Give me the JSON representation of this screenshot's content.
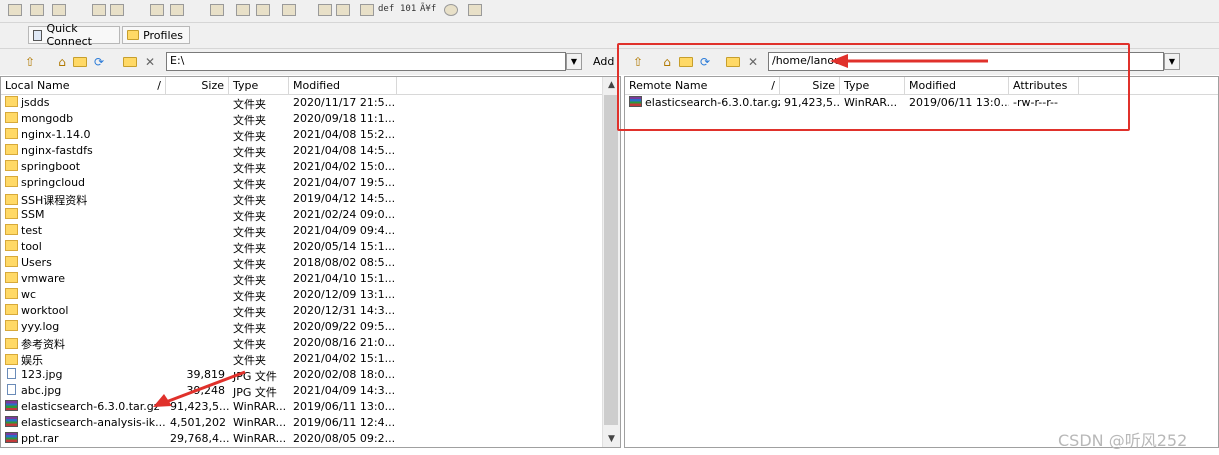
{
  "toolbar": {
    "quick_connect": "Quick Connect",
    "profiles": "Profiles",
    "text_tools": [
      "def",
      "101",
      "Ã¥f"
    ]
  },
  "local": {
    "path": "E:\\",
    "add_label": "Add",
    "headers": {
      "name": "Local Name",
      "sort": "/",
      "size": "Size",
      "type": "Type",
      "modified": "Modified"
    },
    "rows": [
      {
        "name": "jsdds",
        "size": "",
        "type": "文件夹",
        "modified": "2020/11/17 21:5...",
        "icon": "folder"
      },
      {
        "name": "mongodb",
        "size": "",
        "type": "文件夹",
        "modified": "2020/09/18 11:1...",
        "icon": "folder"
      },
      {
        "name": "nginx-1.14.0",
        "size": "",
        "type": "文件夹",
        "modified": "2021/04/08 15:2...",
        "icon": "folder"
      },
      {
        "name": "nginx-fastdfs",
        "size": "",
        "type": "文件夹",
        "modified": "2021/04/08 14:5...",
        "icon": "folder"
      },
      {
        "name": "springboot",
        "size": "",
        "type": "文件夹",
        "modified": "2021/04/02 15:0...",
        "icon": "folder"
      },
      {
        "name": "springcloud",
        "size": "",
        "type": "文件夹",
        "modified": "2021/04/07 19:5...",
        "icon": "folder"
      },
      {
        "name": "SSH课程资料",
        "size": "",
        "type": "文件夹",
        "modified": "2019/04/12 14:5...",
        "icon": "folder"
      },
      {
        "name": "SSM",
        "size": "",
        "type": "文件夹",
        "modified": "2021/02/24 09:0...",
        "icon": "folder"
      },
      {
        "name": "test",
        "size": "",
        "type": "文件夹",
        "modified": "2021/04/09 09:4...",
        "icon": "folder"
      },
      {
        "name": "tool",
        "size": "",
        "type": "文件夹",
        "modified": "2020/05/14 15:1...",
        "icon": "folder"
      },
      {
        "name": "Users",
        "size": "",
        "type": "文件夹",
        "modified": "2018/08/02 08:5...",
        "icon": "folder"
      },
      {
        "name": "vmware",
        "size": "",
        "type": "文件夹",
        "modified": "2021/04/10 15:1...",
        "icon": "folder"
      },
      {
        "name": "wc",
        "size": "",
        "type": "文件夹",
        "modified": "2020/12/09 13:1...",
        "icon": "folder"
      },
      {
        "name": "worktool",
        "size": "",
        "type": "文件夹",
        "modified": "2020/12/31 14:3...",
        "icon": "folder"
      },
      {
        "name": "yyy.log",
        "size": "",
        "type": "文件夹",
        "modified": "2020/09/22 09:5...",
        "icon": "folder"
      },
      {
        "name": "参考资料",
        "size": "",
        "type": "文件夹",
        "modified": "2020/08/16 21:0...",
        "icon": "folder"
      },
      {
        "name": "娱乐",
        "size": "",
        "type": "文件夹",
        "modified": "2021/04/02 15:1...",
        "icon": "folder"
      },
      {
        "name": "123.jpg",
        "size": "39,819",
        "type": "JPG 文件",
        "modified": "2020/02/08 18:0...",
        "icon": "file"
      },
      {
        "name": "abc.jpg",
        "size": "39,248",
        "type": "JPG 文件",
        "modified": "2021/04/09 14:3...",
        "icon": "file"
      },
      {
        "name": "elasticsearch-6.3.0.tar.gz",
        "size": "91,423,5...",
        "type": "WinRAR...",
        "modified": "2019/06/11 13:0...",
        "icon": "rar"
      },
      {
        "name": "elasticsearch-analysis-ik...",
        "size": "4,501,202",
        "type": "WinRAR...",
        "modified": "2019/06/11 12:4...",
        "icon": "rar"
      },
      {
        "name": "ppt.rar",
        "size": "29,768,4...",
        "type": "WinRAR...",
        "modified": "2020/08/05 09:2...",
        "icon": "rar"
      }
    ]
  },
  "remote": {
    "path": "/home/lanou",
    "headers": {
      "name": "Remote Name",
      "sort": "/",
      "size": "Size",
      "type": "Type",
      "modified": "Modified",
      "attributes": "Attributes"
    },
    "rows": [
      {
        "name": "elasticsearch-6.3.0.tar.gz",
        "size": "91,423,5...",
        "type": "WinRAR...",
        "modified": "2019/06/11 13:0...",
        "attributes": "-rw-r--r--",
        "icon": "rar"
      }
    ]
  },
  "watermark": "CSDN @听风252",
  "colors": {
    "annotation": "#e0312b",
    "folder": "#ffd966",
    "toolbar": "#f0f0f0"
  }
}
